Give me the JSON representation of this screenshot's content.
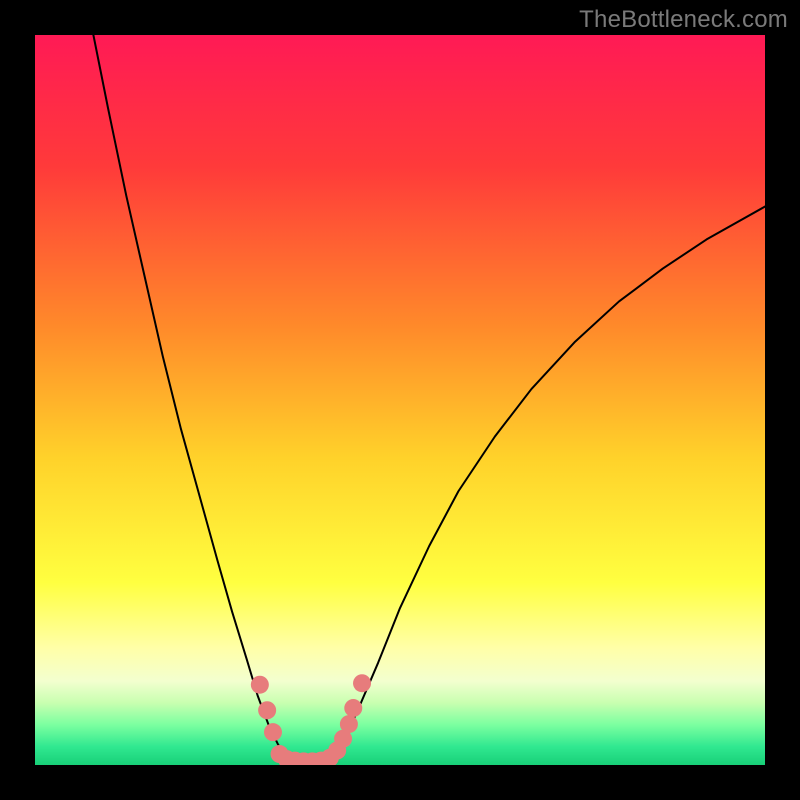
{
  "watermark": "TheBottleneck.com",
  "chart_data": {
    "type": "line",
    "title": "",
    "xlabel": "",
    "ylabel": "",
    "xlim": [
      0,
      100
    ],
    "ylim": [
      0,
      100
    ],
    "background_gradient_stops": [
      {
        "offset": 0.0,
        "color": "#ff1a55"
      },
      {
        "offset": 0.18,
        "color": "#ff3a3a"
      },
      {
        "offset": 0.4,
        "color": "#ff8a2a"
      },
      {
        "offset": 0.58,
        "color": "#ffd22a"
      },
      {
        "offset": 0.75,
        "color": "#ffff40"
      },
      {
        "offset": 0.84,
        "color": "#ffffa8"
      },
      {
        "offset": 0.885,
        "color": "#f3ffcf"
      },
      {
        "offset": 0.915,
        "color": "#c8ffb0"
      },
      {
        "offset": 0.945,
        "color": "#7bffa0"
      },
      {
        "offset": 0.975,
        "color": "#30e890"
      },
      {
        "offset": 1.0,
        "color": "#18d078"
      }
    ],
    "series": [
      {
        "name": "curve-left",
        "stroke": "#000000",
        "stroke_width": 2,
        "points": [
          {
            "x": 8.0,
            "y": 100.0
          },
          {
            "x": 10.0,
            "y": 90.0
          },
          {
            "x": 12.5,
            "y": 78.0
          },
          {
            "x": 15.0,
            "y": 67.0
          },
          {
            "x": 17.5,
            "y": 56.0
          },
          {
            "x": 20.0,
            "y": 46.0
          },
          {
            "x": 22.5,
            "y": 37.0
          },
          {
            "x": 25.0,
            "y": 28.0
          },
          {
            "x": 27.0,
            "y": 21.0
          },
          {
            "x": 29.0,
            "y": 14.5
          },
          {
            "x": 30.5,
            "y": 9.5
          },
          {
            "x": 32.0,
            "y": 5.5
          },
          {
            "x": 33.3,
            "y": 2.8
          },
          {
            "x": 34.5,
            "y": 1.2
          },
          {
            "x": 36.0,
            "y": 0.3
          },
          {
            "x": 37.5,
            "y": 0.0
          }
        ]
      },
      {
        "name": "curve-right",
        "stroke": "#000000",
        "stroke_width": 2,
        "points": [
          {
            "x": 37.5,
            "y": 0.0
          },
          {
            "x": 39.0,
            "y": 0.2
          },
          {
            "x": 40.5,
            "y": 1.0
          },
          {
            "x": 42.0,
            "y": 3.0
          },
          {
            "x": 44.0,
            "y": 7.0
          },
          {
            "x": 47.0,
            "y": 14.0
          },
          {
            "x": 50.0,
            "y": 21.5
          },
          {
            "x": 54.0,
            "y": 30.0
          },
          {
            "x": 58.0,
            "y": 37.5
          },
          {
            "x": 63.0,
            "y": 45.0
          },
          {
            "x": 68.0,
            "y": 51.5
          },
          {
            "x": 74.0,
            "y": 58.0
          },
          {
            "x": 80.0,
            "y": 63.5
          },
          {
            "x": 86.0,
            "y": 68.0
          },
          {
            "x": 92.0,
            "y": 72.0
          },
          {
            "x": 100.0,
            "y": 76.5
          }
        ]
      }
    ],
    "overlay_dots": {
      "name": "pink-dots",
      "fill": "#e77c7c",
      "radius": 9,
      "points": [
        {
          "x": 30.8,
          "y": 11.0
        },
        {
          "x": 31.8,
          "y": 7.5
        },
        {
          "x": 32.6,
          "y": 4.5
        },
        {
          "x": 33.5,
          "y": 1.5
        },
        {
          "x": 34.5,
          "y": 0.8
        },
        {
          "x": 35.6,
          "y": 0.6
        },
        {
          "x": 36.8,
          "y": 0.5
        },
        {
          "x": 38.0,
          "y": 0.5
        },
        {
          "x": 39.2,
          "y": 0.6
        },
        {
          "x": 40.4,
          "y": 1.0
        },
        {
          "x": 41.4,
          "y": 2.0
        },
        {
          "x": 42.2,
          "y": 3.6
        },
        {
          "x": 43.0,
          "y": 5.6
        },
        {
          "x": 43.6,
          "y": 7.8
        },
        {
          "x": 44.8,
          "y": 11.2
        }
      ]
    }
  }
}
